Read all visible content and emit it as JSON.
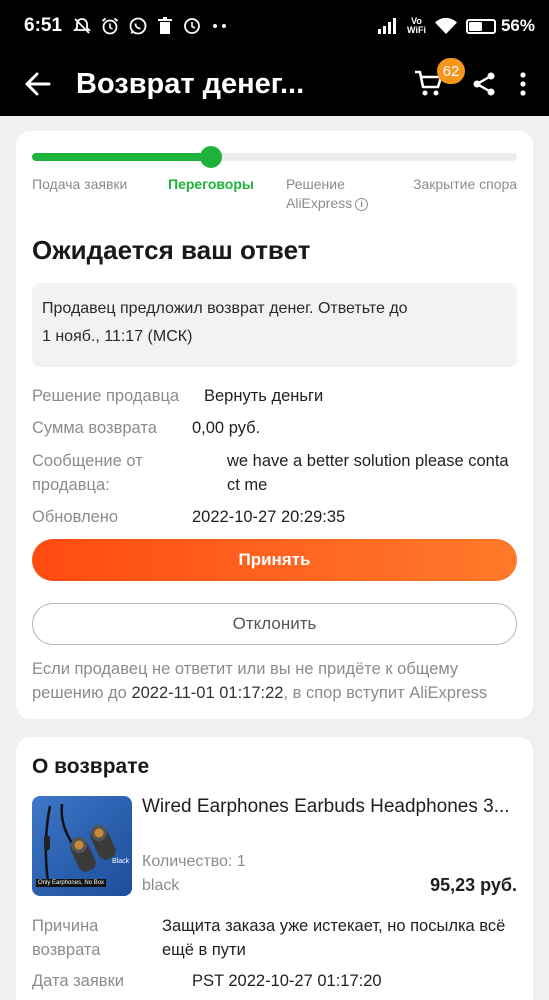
{
  "statusbar": {
    "time": "6:51",
    "icons": [
      "mute-icon",
      "alarm-icon",
      "whatsapp-icon",
      "trash-icon",
      "clock-icon",
      "more-dots-icon"
    ],
    "volte_top": "Vo",
    "volte_bottom": "WiFi",
    "battery_level": 0.56,
    "battery_text": "56%"
  },
  "appbar": {
    "title": "Возврат денег...",
    "cart_count": "62"
  },
  "progress": {
    "fraction": 0.37,
    "steps": [
      {
        "label": "Подача заявки"
      },
      {
        "label": "Переговоры"
      },
      {
        "label": "Решение"
      },
      {
        "label": "AliExpress"
      },
      {
        "label": "Закрытие спора"
      }
    ]
  },
  "dispute": {
    "status_title": "Ожидается ваш ответ",
    "notice_line1": "Продавец предложил возврат денег. Ответьте до",
    "notice_line2": "1 нояб., 11:17 (МСК)",
    "rows": [
      {
        "label": "Решение продавца",
        "value": "Вернуть деньги"
      },
      {
        "label": "Сумма возврата",
        "value": "0,00 руб."
      },
      {
        "label_line1": "Сообщение от",
        "label_line2": "продавца:",
        "value_line1": "we have a better solution please conta",
        "value_line2": "ct me"
      },
      {
        "label": "Обновлено",
        "value": "2022-10-27 20:29:35"
      }
    ],
    "accept_label": "Принять",
    "decline_label": "Отклонить",
    "footnote_line1": "Если продавец не ответит или вы не придёте к общему",
    "footnote_prefix": "решению до ",
    "footnote_date": "2022-11-01 01:17:22",
    "footnote_suffix": ", в спор вступит AliExpress"
  },
  "refund": {
    "title": "О возврате",
    "product_title": "Wired Earphones Earbuds Headphones 3...",
    "image_caption_1": "Black",
    "image_caption_2": "Only Earphones, No Box",
    "quantity": "Количество: 1",
    "variant": "black",
    "price": "95,23 руб.",
    "reason_label_1": "Причина",
    "reason_label_2": "возврата",
    "reason_value_1": "Защита заказа уже истекает, но посылка всё",
    "reason_value_2": "ещё в пути",
    "date_label": "Дата заявки",
    "date_value": "PST 2022-10-27 01:17:20"
  }
}
